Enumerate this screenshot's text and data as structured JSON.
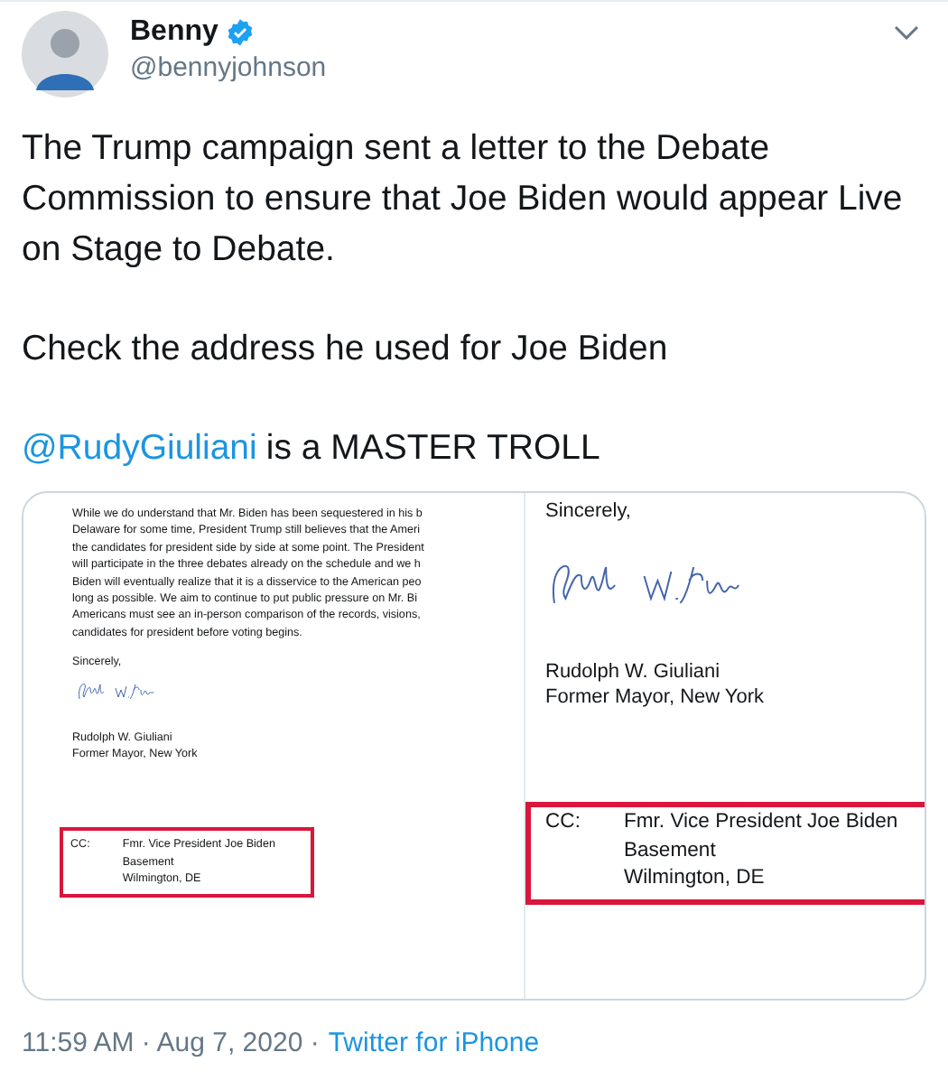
{
  "author": {
    "name": "Benny",
    "verified": true,
    "handle": "@bennyjohnson"
  },
  "paragraphs": [
    "The Trump campaign sent a letter to the Debate Commission to ensure that Joe Biden would appear Live on Stage to Debate.",
    "Check the address he used for Joe Biden"
  ],
  "mention_line": {
    "mention": "@RudyGiuliani",
    "text": "is a MASTER TROLL"
  },
  "attachment": {
    "left_page": {
      "body_lines": [
        "While we do understand that Mr. Biden has been sequestered in his b",
        "Delaware for some time, President Trump still believes that the Ameri",
        "the candidates for president side by side at some point. The President",
        "will participate in the three debates already on the schedule and we h",
        "Biden will eventually realize that it is a disservice to the American peo",
        "long as possible. We aim to continue to put public pressure on Mr. Bi",
        "Americans must see an in-person comparison of the records, visions,",
        "candidates for president before voting begins."
      ],
      "closing": "Sincerely,",
      "signer_lines": [
        "Rudolph W. Giuliani",
        "Former Mayor, New York"
      ],
      "cc": {
        "label": "CC:",
        "lines": [
          "Fmr. Vice President Joe Biden",
          "Basement",
          "Wilmington, DE"
        ]
      }
    },
    "right_page": {
      "closing": "Sincerely,",
      "signer_lines": [
        "Rudolph W. Giuliani",
        "Former Mayor, New York"
      ],
      "cc": {
        "label": "CC:",
        "lines": [
          "Fmr. Vice President Joe Biden",
          "Basement",
          "Wilmington, DE"
        ]
      }
    }
  },
  "footer": {
    "meta": "11:59 AM · Aug 7, 2020 ·",
    "source": "Twitter for iPhone"
  }
}
